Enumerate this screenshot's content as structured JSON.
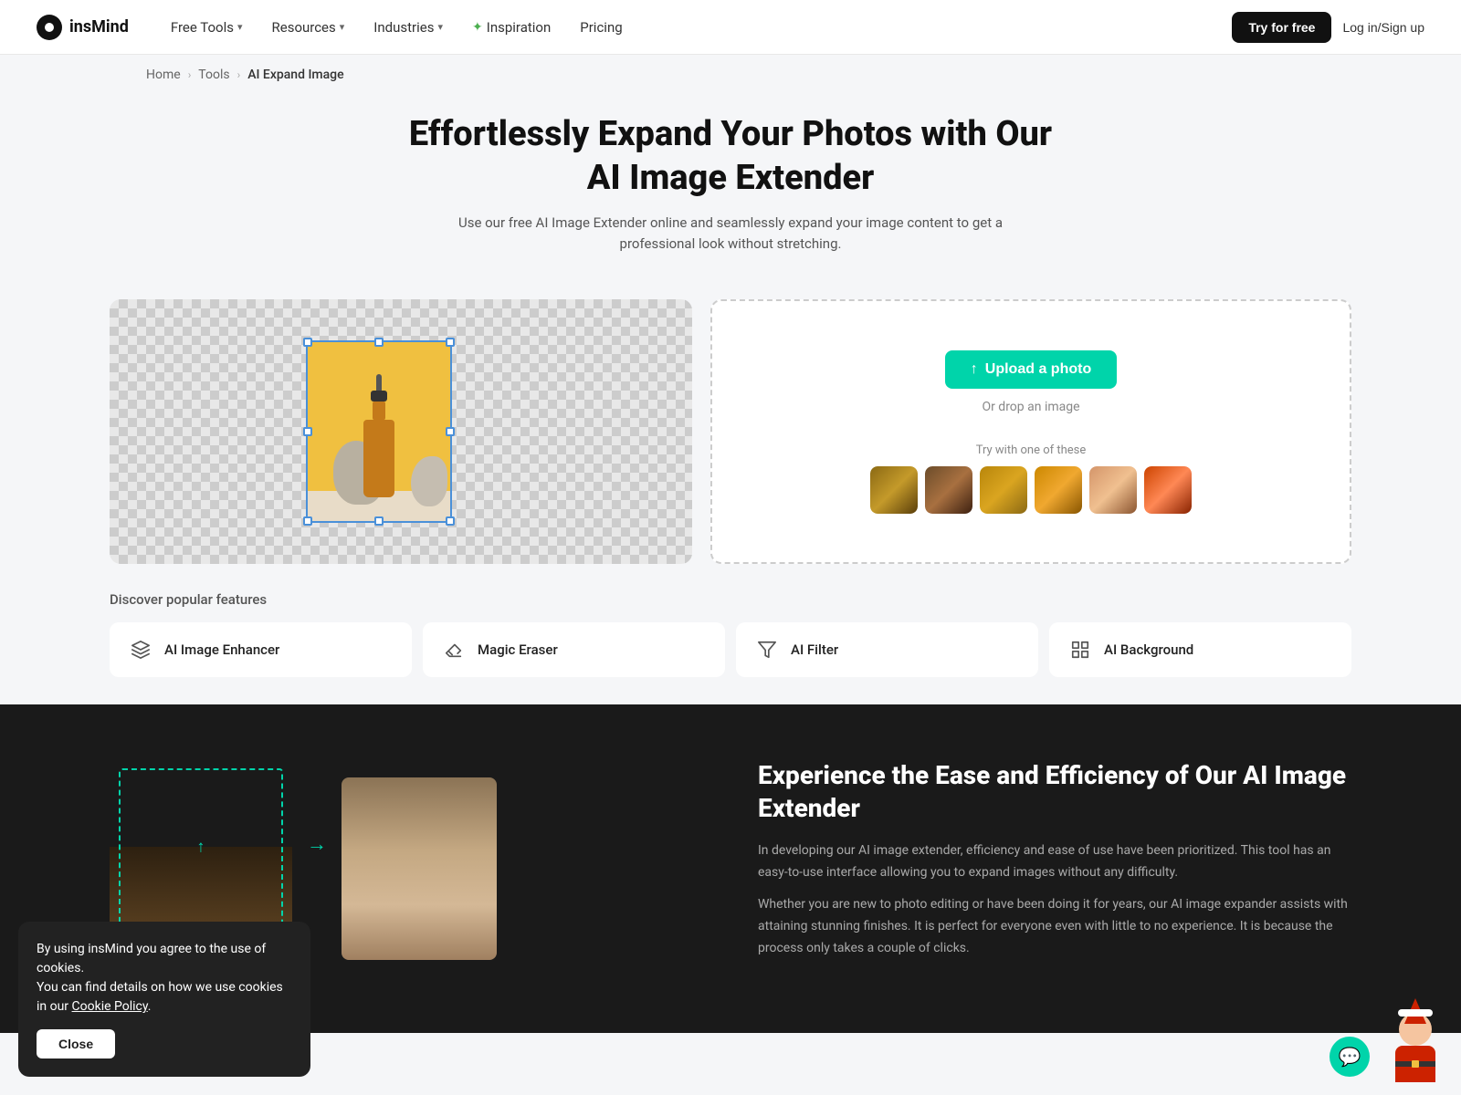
{
  "logo": {
    "name": "insMind",
    "full": "insMind"
  },
  "nav": {
    "items": [
      {
        "label": "Free Tools",
        "hasDropdown": true
      },
      {
        "label": "Resources",
        "hasDropdown": true
      },
      {
        "label": "Industries",
        "hasDropdown": true
      },
      {
        "label": "Inspiration",
        "hasStar": true
      },
      {
        "label": "Pricing",
        "hasDropdown": false
      }
    ],
    "try_btn": "Try for free",
    "login_btn": "Log in/Sign up"
  },
  "breadcrumb": {
    "home": "Home",
    "tools": "Tools",
    "current": "AI Expand Image"
  },
  "hero": {
    "title": "Effortlessly Expand Your Photos with Our AI Image Extender",
    "subtitle": "Use our free AI Image Extender online and seamlessly expand your image content to get a professional look without stretching."
  },
  "upload": {
    "btn_label": "Upload a photo",
    "drop_label": "Or drop an image",
    "try_label": "Try with one of these"
  },
  "features": {
    "section_title": "Discover popular features",
    "items": [
      {
        "label": "AI Image Enhancer",
        "icon": "layers"
      },
      {
        "label": "Magic Eraser",
        "icon": "eraser"
      },
      {
        "label": "AI Filter",
        "icon": "filter"
      },
      {
        "label": "AI Background",
        "icon": "grid"
      }
    ]
  },
  "lower": {
    "title": "Experience the Ease and Efficiency of Our AI Image Extender",
    "paragraphs": [
      "In developing our AI image extender, efficiency and ease of use have been prioritized. This tool has an easy-to-use interface allowing you to expand images without any difficulty.",
      "Whether you are new to photo editing or have been doing it for years, our AI image expander assists with attaining stunning finishes. It is perfect for everyone even with little to no experience. It is because the process only takes a couple of clicks."
    ]
  },
  "cookie": {
    "text1": "By using insMind you agree to the use of cookies.",
    "text2": "You can find details on how we use cookies in our",
    "link": "Cookie Policy",
    "btn": "Close"
  }
}
